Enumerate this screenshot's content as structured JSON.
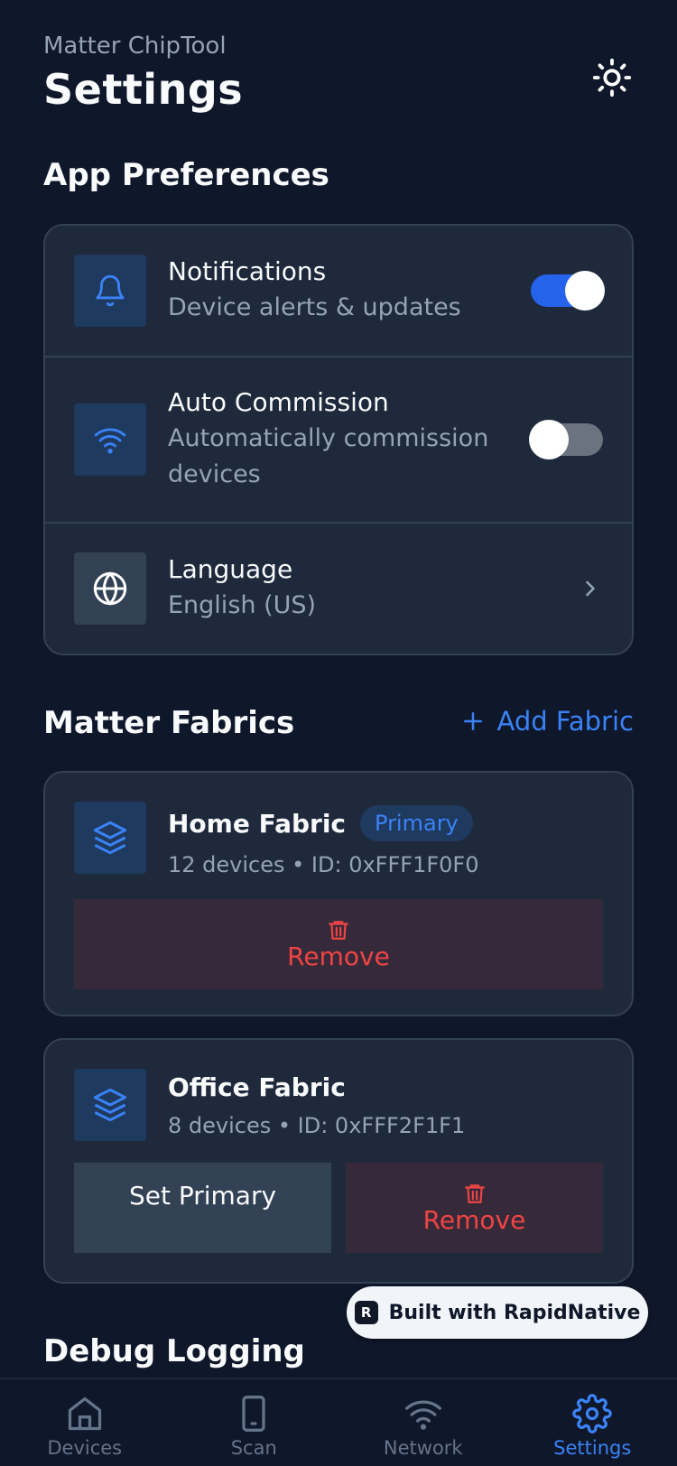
{
  "header": {
    "app_name": "Matter ChipTool",
    "title": "Settings"
  },
  "app_preferences": {
    "title": "App Preferences",
    "notifications": {
      "title": "Notifications",
      "subtitle": "Device alerts & updates",
      "enabled": true
    },
    "auto_commission": {
      "title": "Auto Commission",
      "subtitle": "Automatically commission devices",
      "enabled": false
    },
    "language": {
      "title": "Language",
      "value": "English (US)"
    }
  },
  "fabrics": {
    "title": "Matter Fabrics",
    "add_label": "Add Fabric",
    "items": [
      {
        "name": "Home Fabric",
        "badge": "Primary",
        "meta": "12 devices • ID: 0xFFF1F0F0",
        "remove_label": "Remove"
      },
      {
        "name": "Office Fabric",
        "meta": "8 devices • ID: 0xFFF2F1F1",
        "set_primary_label": "Set Primary",
        "remove_label": "Remove"
      }
    ]
  },
  "debug": {
    "title": "Debug Logging"
  },
  "rapid_badge": {
    "label": "Built with RapidNative"
  },
  "tabs": [
    {
      "label": "Devices",
      "icon": "home-icon"
    },
    {
      "label": "Scan",
      "icon": "phone-icon"
    },
    {
      "label": "Network",
      "icon": "wifi-icon"
    },
    {
      "label": "Settings",
      "icon": "gear-icon",
      "active": true
    }
  ],
  "colors": {
    "accent": "#3b82f6",
    "danger": "#ef4444",
    "background": "#0f172a",
    "card": "#1e293b"
  }
}
